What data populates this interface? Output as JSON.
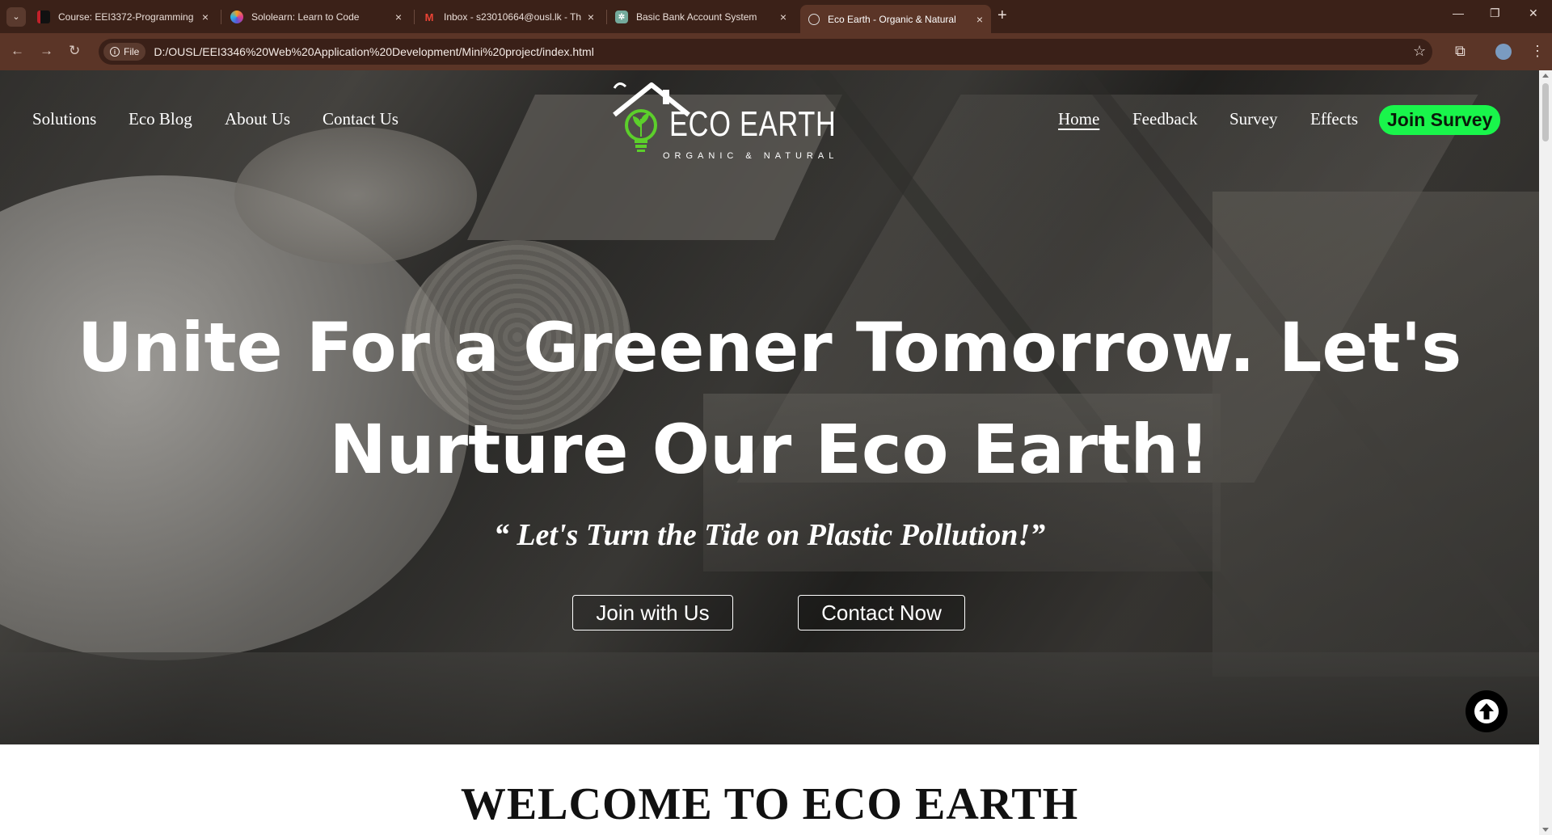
{
  "browser": {
    "tabs": [
      {
        "title": "Course: EEI3372-Programming",
        "icon": "course-icon",
        "active": false
      },
      {
        "title": "Sololearn: Learn to Code",
        "icon": "sololearn-icon",
        "active": false
      },
      {
        "title": "Inbox - s23010664@ousl.lk - Th",
        "icon": "gmail-icon",
        "active": false
      },
      {
        "title": "Basic Bank Account System",
        "icon": "chatgpt-icon",
        "active": false
      },
      {
        "title": "Eco Earth - Organic & Natural",
        "icon": "globe-icon",
        "active": true
      }
    ],
    "new_tab_symbol": "+",
    "close_symbol": "×",
    "window_controls": {
      "minimize": "—",
      "restore": "❐",
      "close": "✕"
    },
    "address": {
      "chip_label": "File",
      "url": "D:/OUSL/EEI3346%20Web%20Application%20Development/Mini%20project/index.html"
    }
  },
  "site": {
    "nav_left": [
      "Solutions",
      "Eco Blog",
      "About Us",
      "Contact Us"
    ],
    "nav_right": [
      "Home",
      "Feedback",
      "Survey",
      "Effects"
    ],
    "active_nav": "Home",
    "join_survey": "Join Survey",
    "logo": {
      "title": "ECO EARTH",
      "subtitle": "ORGANIC & NATURAL"
    },
    "hero": {
      "headline_line1": "Unite For a Greener Tomorrow. Let's",
      "headline_line2": "Nurture Our Eco Earth!",
      "tagline": "“ Let's Turn the Tide on Plastic Pollution!”",
      "btn_join": "Join with Us",
      "btn_contact": "Contact Now"
    },
    "welcome": "WELCOME TO ECO EARTH"
  },
  "colors": {
    "tabbar": "#3b2118",
    "toolbar": "#5b3527",
    "accent_green": "#19f54b",
    "logo_green": "#5ccf2b"
  }
}
